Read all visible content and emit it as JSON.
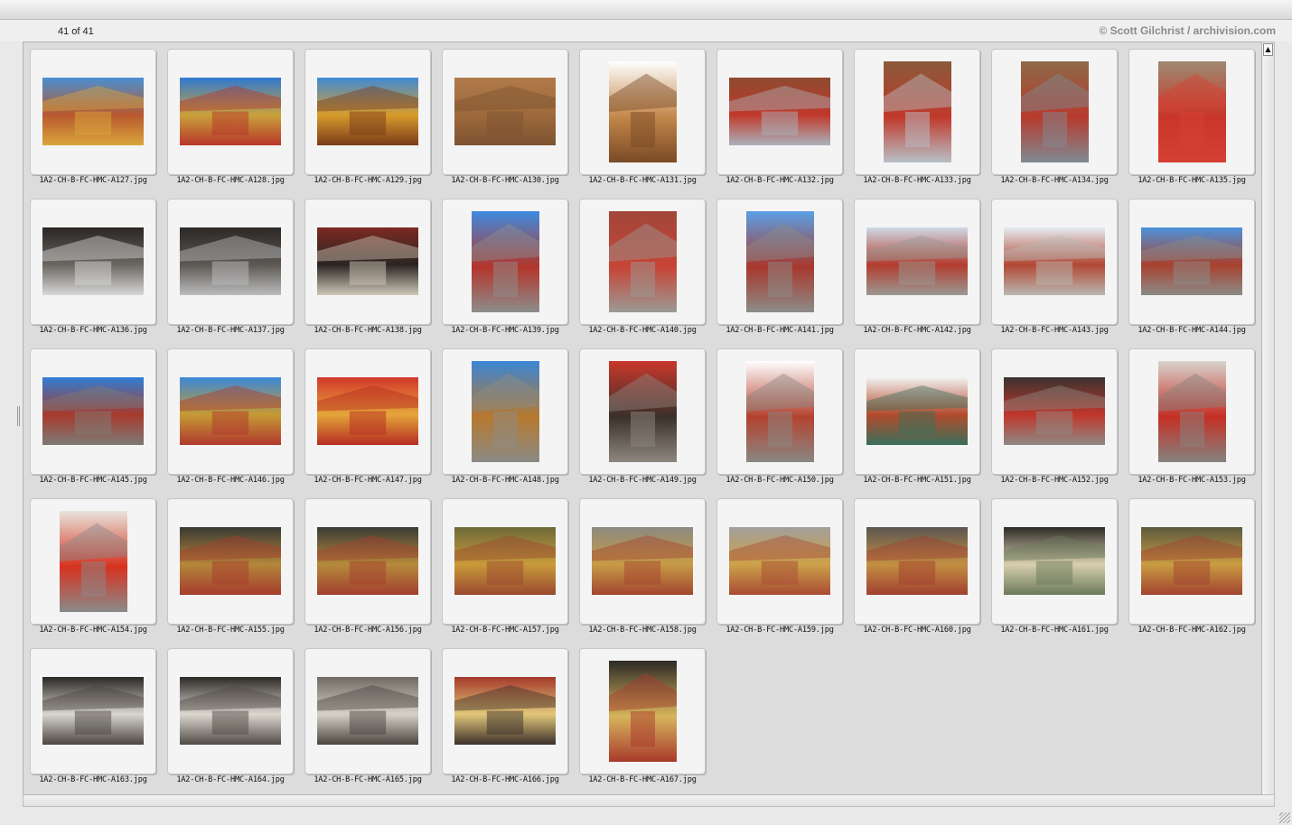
{
  "header": {
    "count_text": "41 of 41",
    "credit": "© Scott Gilchrist / archivision.com"
  },
  "scroll_up_glyph": "▲",
  "thumbnails": [
    {
      "caption": "1A2-CH-B-FC-HMC-A127.jpg",
      "orientation": "landscape",
      "palette": [
        "#4a8fd1",
        "#b8582e",
        "#d9a53b"
      ]
    },
    {
      "caption": "1A2-CH-B-FC-HMC-A128.jpg",
      "orientation": "landscape",
      "palette": [
        "#2f78d2",
        "#c9a23b",
        "#b7362a"
      ]
    },
    {
      "caption": "1A2-CH-B-FC-HMC-A129.jpg",
      "orientation": "landscape",
      "palette": [
        "#3f8ad6",
        "#d89c2c",
        "#7a3b1a"
      ]
    },
    {
      "caption": "1A2-CH-B-FC-HMC-A130.jpg",
      "orientation": "landscape",
      "palette": [
        "#b07a4a",
        "#9e6a3c",
        "#7d5231"
      ]
    },
    {
      "caption": "1A2-CH-B-FC-HMC-A131.jpg",
      "orientation": "portrait",
      "palette": [
        "#ffffff",
        "#c3874a",
        "#7a4a25"
      ]
    },
    {
      "caption": "1A2-CH-B-FC-HMC-A132.jpg",
      "orientation": "landscape",
      "palette": [
        "#8e4a2e",
        "#c0392b",
        "#aab2bb"
      ]
    },
    {
      "caption": "1A2-CH-B-FC-HMC-A133.jpg",
      "orientation": "portrait",
      "palette": [
        "#8a5a3a",
        "#c0392b",
        "#b8c0c8"
      ]
    },
    {
      "caption": "1A2-CH-B-FC-HMC-A134.jpg",
      "orientation": "portrait",
      "palette": [
        "#8c6a48",
        "#b83a2d",
        "#7f8a93"
      ]
    },
    {
      "caption": "1A2-CH-B-FC-HMC-A135.jpg",
      "orientation": "portrait",
      "palette": [
        "#9e8a70",
        "#c8362a",
        "#d74034"
      ]
    },
    {
      "caption": "1A2-CH-B-FC-HMC-A136.jpg",
      "orientation": "landscape",
      "palette": [
        "#2a2624",
        "#6b6660",
        "#d8d8d8"
      ]
    },
    {
      "caption": "1A2-CH-B-FC-HMC-A137.jpg",
      "orientation": "landscape",
      "palette": [
        "#2b2826",
        "#5c5854",
        "#bdbdbd"
      ]
    },
    {
      "caption": "1A2-CH-B-FC-HMC-A138.jpg",
      "orientation": "landscape",
      "palette": [
        "#7b2a22",
        "#2a2522",
        "#cfc8b8"
      ]
    },
    {
      "caption": "1A2-CH-B-FC-HMC-A139.jpg",
      "orientation": "portrait",
      "palette": [
        "#3d8be0",
        "#b3352a",
        "#8d8d8d"
      ]
    },
    {
      "caption": "1A2-CH-B-FC-HMC-A140.jpg",
      "orientation": "portrait",
      "palette": [
        "#a1473a",
        "#c74436",
        "#9a9a94"
      ]
    },
    {
      "caption": "1A2-CH-B-FC-HMC-A141.jpg",
      "orientation": "portrait",
      "palette": [
        "#5aa0e6",
        "#a8372d",
        "#8c8c88"
      ]
    },
    {
      "caption": "1A2-CH-B-FC-HMC-A142.jpg",
      "orientation": "landscape",
      "palette": [
        "#cfd9e6",
        "#b33c2f",
        "#9a9892"
      ]
    },
    {
      "caption": "1A2-CH-B-FC-HMC-A143.jpg",
      "orientation": "landscape",
      "palette": [
        "#e6ecf2",
        "#b24834",
        "#b9b7b1"
      ]
    },
    {
      "caption": "1A2-CH-B-FC-HMC-A144.jpg",
      "orientation": "landscape",
      "palette": [
        "#4b92dc",
        "#a8412f",
        "#8c8b87"
      ]
    },
    {
      "caption": "1A2-CH-B-FC-HMC-A145.jpg",
      "orientation": "landscape",
      "palette": [
        "#2f7ed6",
        "#a8392d",
        "#7d7b76"
      ]
    },
    {
      "caption": "1A2-CH-B-FC-HMC-A146.jpg",
      "orientation": "landscape",
      "palette": [
        "#3a88d8",
        "#c69a34",
        "#b0392d"
      ]
    },
    {
      "caption": "1A2-CH-B-FC-HMC-A147.jpg",
      "orientation": "landscape",
      "palette": [
        "#d2382a",
        "#e4a53a",
        "#b52c22"
      ]
    },
    {
      "caption": "1A2-CH-B-FC-HMC-A148.jpg",
      "orientation": "portrait",
      "palette": [
        "#3a86d6",
        "#b6782f",
        "#8b8b86"
      ]
    },
    {
      "caption": "1A2-CH-B-FC-HMC-A149.jpg",
      "orientation": "portrait",
      "palette": [
        "#c9372b",
        "#3b302a",
        "#8d8780"
      ]
    },
    {
      "caption": "1A2-CH-B-FC-HMC-A150.jpg",
      "orientation": "portrait",
      "palette": [
        "#ffffff",
        "#b4422f",
        "#8a8783"
      ]
    },
    {
      "caption": "1A2-CH-B-FC-HMC-A151.jpg",
      "orientation": "landscape",
      "palette": [
        "#f2f2f2",
        "#b34b2c",
        "#3a6f5a"
      ]
    },
    {
      "caption": "1A2-CH-B-FC-HMC-A152.jpg",
      "orientation": "landscape",
      "palette": [
        "#3a3330",
        "#c0362b",
        "#8e8a85"
      ]
    },
    {
      "caption": "1A2-CH-B-FC-HMC-A153.jpg",
      "orientation": "portrait",
      "palette": [
        "#d8d4cd",
        "#c52f24",
        "#858380"
      ]
    },
    {
      "caption": "1A2-CH-B-FC-HMC-A154.jpg",
      "orientation": "portrait",
      "palette": [
        "#e8e4dc",
        "#d7321f",
        "#8a8a8a"
      ]
    },
    {
      "caption": "1A2-CH-B-FC-HMC-A155.jpg",
      "orientation": "landscape",
      "palette": [
        "#3a3a34",
        "#b4863a",
        "#a53c2c"
      ]
    },
    {
      "caption": "1A2-CH-B-FC-HMC-A156.jpg",
      "orientation": "landscape",
      "palette": [
        "#3b3b36",
        "#b58a3b",
        "#a33f2e"
      ]
    },
    {
      "caption": "1A2-CH-B-FC-HMC-A157.jpg",
      "orientation": "landscape",
      "palette": [
        "#6f6a3a",
        "#c89a3a",
        "#9b4a2f"
      ]
    },
    {
      "caption": "1A2-CH-B-FC-HMC-A158.jpg",
      "orientation": "landscape",
      "palette": [
        "#8c8a80",
        "#c79b46",
        "#a3452f"
      ]
    },
    {
      "caption": "1A2-CH-B-FC-HMC-A159.jpg",
      "orientation": "landscape",
      "palette": [
        "#a2a09a",
        "#cda14a",
        "#a84b33"
      ]
    },
    {
      "caption": "1A2-CH-B-FC-HMC-A160.jpg",
      "orientation": "landscape",
      "palette": [
        "#5b5650",
        "#c38f42",
        "#a1402f"
      ]
    },
    {
      "caption": "1A2-CH-B-FC-HMC-A161.jpg",
      "orientation": "landscape",
      "palette": [
        "#2e2b28",
        "#d8cfae",
        "#6a7a5a"
      ]
    },
    {
      "caption": "1A2-CH-B-FC-HMC-A162.jpg",
      "orientation": "landscape",
      "palette": [
        "#5c5a3e",
        "#c99c42",
        "#a2432f"
      ]
    },
    {
      "caption": "1A2-CH-B-FC-HMC-A163.jpg",
      "orientation": "landscape",
      "palette": [
        "#2a2724",
        "#d9d6cf",
        "#4b4540"
      ]
    },
    {
      "caption": "1A2-CH-B-FC-HMC-A164.jpg",
      "orientation": "landscape",
      "palette": [
        "#2c2926",
        "#dcd8d0",
        "#504a44"
      ]
    },
    {
      "caption": "1A2-CH-B-FC-HMC-A165.jpg",
      "orientation": "landscape",
      "palette": [
        "#6f6a63",
        "#d6d1c8",
        "#4a443e"
      ]
    },
    {
      "caption": "1A2-CH-B-FC-HMC-A166.jpg",
      "orientation": "landscape",
      "palette": [
        "#a53a2b",
        "#e1c77a",
        "#3b302a"
      ]
    },
    {
      "caption": "1A2-CH-B-FC-HMC-A167.jpg",
      "orientation": "portrait",
      "palette": [
        "#2d2a27",
        "#d7b45c",
        "#a83a2c"
      ]
    }
  ]
}
